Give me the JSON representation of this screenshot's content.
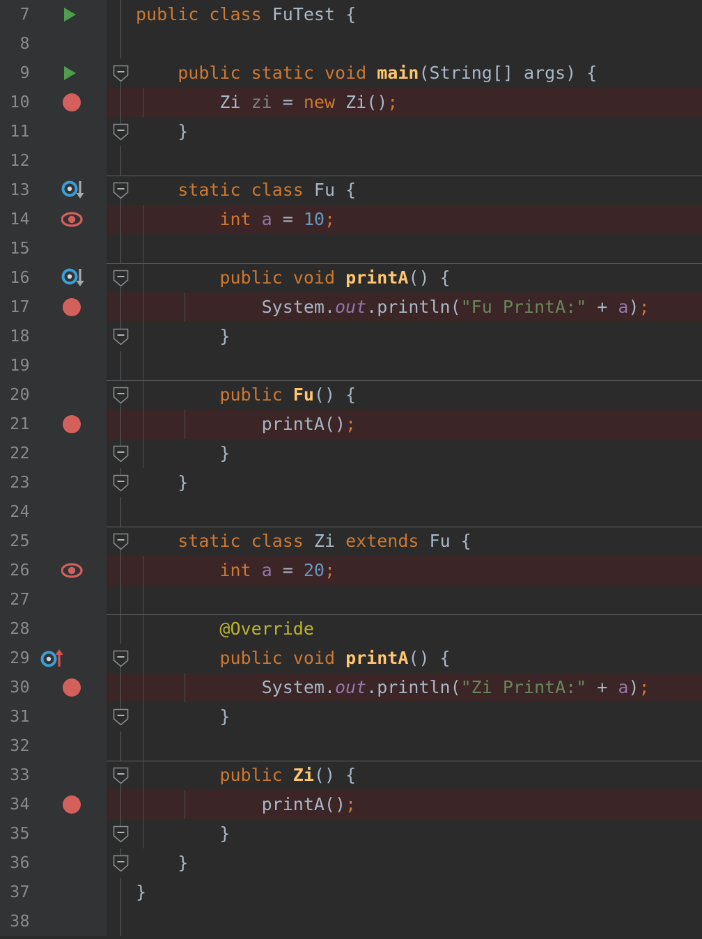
{
  "editor": {
    "colors": {
      "background": "#2b2b2b",
      "gutter_background": "#313335",
      "highlight_line": "#3b2526",
      "line_number": "#888b8d",
      "default_text": "#a9b7c6",
      "keyword": "#cc7832",
      "method": "#ffc66d",
      "field": "#9876aa",
      "number": "#6897bb",
      "string": "#6a8759",
      "annotation": "#bbb529",
      "dimmed": "#808080",
      "breakpoint": "#d4605c",
      "run_marker": "#4f9e4f",
      "implemented_marker": "#389fd6"
    },
    "language": "java",
    "first_visible_line": 7,
    "last_visible_line": 38,
    "lines": [
      {
        "number": "7",
        "icon": "run-icon",
        "highlighted": false,
        "fold": "none",
        "separator": false,
        "indent_guides": 0,
        "tokens": [
          {
            "t": "public",
            "c": "kw"
          },
          {
            "t": " ",
            "c": "pln"
          },
          {
            "t": "class",
            "c": "kw"
          },
          {
            "t": " ",
            "c": "pln"
          },
          {
            "t": "FuTest",
            "c": "cls"
          },
          {
            "t": " {",
            "c": "pln"
          }
        ]
      },
      {
        "number": "8",
        "icon": "none",
        "highlighted": false,
        "fold": "none",
        "separator": false,
        "indent_guides": 0,
        "tokens": []
      },
      {
        "number": "9",
        "icon": "run-icon",
        "highlighted": false,
        "fold": "start",
        "separator": false,
        "indent_guides": 0,
        "tokens": [
          {
            "t": "    ",
            "c": "pln"
          },
          {
            "t": "public",
            "c": "kw"
          },
          {
            "t": " ",
            "c": "pln"
          },
          {
            "t": "static",
            "c": "kw"
          },
          {
            "t": " ",
            "c": "pln"
          },
          {
            "t": "void",
            "c": "kw"
          },
          {
            "t": " ",
            "c": "pln"
          },
          {
            "t": "main",
            "c": "mth bold"
          },
          {
            "t": "(String[] args) {",
            "c": "pln"
          }
        ]
      },
      {
        "number": "10",
        "icon": "breakpoint-icon",
        "highlighted": true,
        "fold": "body",
        "separator": false,
        "indent_guides": 1,
        "tokens": [
          {
            "t": "        ",
            "c": "pln"
          },
          {
            "t": "Zi",
            "c": "cls"
          },
          {
            "t": " ",
            "c": "pln"
          },
          {
            "t": "zi",
            "c": "dim"
          },
          {
            "t": " = ",
            "c": "pln"
          },
          {
            "t": "new",
            "c": "kw"
          },
          {
            "t": " ",
            "c": "pln"
          },
          {
            "t": "Zi",
            "c": "cls"
          },
          {
            "t": "()",
            "c": "pln"
          },
          {
            "t": ";",
            "c": "kw"
          }
        ]
      },
      {
        "number": "11",
        "icon": "none",
        "highlighted": false,
        "fold": "end",
        "separator": false,
        "indent_guides": 0,
        "tokens": [
          {
            "t": "    }",
            "c": "pln"
          }
        ]
      },
      {
        "number": "12",
        "icon": "none",
        "highlighted": false,
        "fold": "none",
        "separator": false,
        "indent_guides": 0,
        "tokens": []
      },
      {
        "number": "13",
        "icon": "overridden-by-icon",
        "highlighted": false,
        "fold": "start",
        "separator": true,
        "indent_guides": 0,
        "tokens": [
          {
            "t": "    ",
            "c": "pln"
          },
          {
            "t": "static",
            "c": "kw"
          },
          {
            "t": " ",
            "c": "pln"
          },
          {
            "t": "class",
            "c": "kw"
          },
          {
            "t": " ",
            "c": "pln"
          },
          {
            "t": "Fu",
            "c": "cls"
          },
          {
            "t": " {",
            "c": "pln"
          }
        ]
      },
      {
        "number": "14",
        "icon": "field-watch-icon",
        "highlighted": true,
        "fold": "body",
        "separator": false,
        "indent_guides": 1,
        "tokens": [
          {
            "t": "        ",
            "c": "pln"
          },
          {
            "t": "int",
            "c": "kw"
          },
          {
            "t": " ",
            "c": "pln"
          },
          {
            "t": "a",
            "c": "fld"
          },
          {
            "t": " = ",
            "c": "pln"
          },
          {
            "t": "10",
            "c": "num"
          },
          {
            "t": ";",
            "c": "kw"
          }
        ]
      },
      {
        "number": "15",
        "icon": "none",
        "highlighted": false,
        "fold": "body",
        "separator": false,
        "indent_guides": 1,
        "tokens": []
      },
      {
        "number": "16",
        "icon": "overridden-by-icon",
        "highlighted": false,
        "fold": "start",
        "separator": true,
        "indent_guides": 1,
        "tokens": [
          {
            "t": "        ",
            "c": "pln"
          },
          {
            "t": "public",
            "c": "kw"
          },
          {
            "t": " ",
            "c": "pln"
          },
          {
            "t": "void",
            "c": "kw"
          },
          {
            "t": " ",
            "c": "pln"
          },
          {
            "t": "printA",
            "c": "mth bold"
          },
          {
            "t": "() {",
            "c": "pln"
          }
        ]
      },
      {
        "number": "17",
        "icon": "breakpoint-icon",
        "highlighted": true,
        "fold": "body",
        "separator": false,
        "indent_guides": 2,
        "tokens": [
          {
            "t": "            ",
            "c": "pln"
          },
          {
            "t": "System",
            "c": "pln"
          },
          {
            "t": ".",
            "c": "pln"
          },
          {
            "t": "out",
            "c": "stat"
          },
          {
            "t": ".println(",
            "c": "pln"
          },
          {
            "t": "\"Fu PrintA:\"",
            "c": "str"
          },
          {
            "t": " + ",
            "c": "pln"
          },
          {
            "t": "a",
            "c": "fld"
          },
          {
            "t": ")",
            "c": "pln"
          },
          {
            "t": ";",
            "c": "kw"
          }
        ]
      },
      {
        "number": "18",
        "icon": "none",
        "highlighted": false,
        "fold": "end",
        "separator": false,
        "indent_guides": 1,
        "tokens": [
          {
            "t": "        }",
            "c": "pln"
          }
        ]
      },
      {
        "number": "19",
        "icon": "none",
        "highlighted": false,
        "fold": "body",
        "separator": false,
        "indent_guides": 1,
        "tokens": []
      },
      {
        "number": "20",
        "icon": "none",
        "highlighted": false,
        "fold": "start",
        "separator": true,
        "indent_guides": 1,
        "tokens": [
          {
            "t": "        ",
            "c": "pln"
          },
          {
            "t": "public",
            "c": "kw"
          },
          {
            "t": " ",
            "c": "pln"
          },
          {
            "t": "Fu",
            "c": "mth bold"
          },
          {
            "t": "() {",
            "c": "pln"
          }
        ]
      },
      {
        "number": "21",
        "icon": "breakpoint-icon",
        "highlighted": true,
        "fold": "body",
        "separator": false,
        "indent_guides": 2,
        "tokens": [
          {
            "t": "            ",
            "c": "pln"
          },
          {
            "t": "printA()",
            "c": "pln"
          },
          {
            "t": ";",
            "c": "kw"
          }
        ]
      },
      {
        "number": "22",
        "icon": "none",
        "highlighted": false,
        "fold": "end",
        "separator": false,
        "indent_guides": 1,
        "tokens": [
          {
            "t": "        }",
            "c": "pln"
          }
        ]
      },
      {
        "number": "23",
        "icon": "none",
        "highlighted": false,
        "fold": "end",
        "separator": false,
        "indent_guides": 0,
        "tokens": [
          {
            "t": "    }",
            "c": "pln"
          }
        ]
      },
      {
        "number": "24",
        "icon": "none",
        "highlighted": false,
        "fold": "none",
        "separator": false,
        "indent_guides": 0,
        "tokens": []
      },
      {
        "number": "25",
        "icon": "none",
        "highlighted": false,
        "fold": "start",
        "separator": true,
        "indent_guides": 0,
        "tokens": [
          {
            "t": "    ",
            "c": "pln"
          },
          {
            "t": "static",
            "c": "kw"
          },
          {
            "t": " ",
            "c": "pln"
          },
          {
            "t": "class",
            "c": "kw"
          },
          {
            "t": " ",
            "c": "pln"
          },
          {
            "t": "Zi",
            "c": "cls"
          },
          {
            "t": " ",
            "c": "pln"
          },
          {
            "t": "extends",
            "c": "kw"
          },
          {
            "t": " ",
            "c": "pln"
          },
          {
            "t": "Fu",
            "c": "cls"
          },
          {
            "t": " {",
            "c": "pln"
          }
        ]
      },
      {
        "number": "26",
        "icon": "field-watch-icon",
        "highlighted": true,
        "fold": "body",
        "separator": false,
        "indent_guides": 1,
        "tokens": [
          {
            "t": "        ",
            "c": "pln"
          },
          {
            "t": "int",
            "c": "kw"
          },
          {
            "t": " ",
            "c": "pln"
          },
          {
            "t": "a",
            "c": "fld"
          },
          {
            "t": " = ",
            "c": "pln"
          },
          {
            "t": "20",
            "c": "num"
          },
          {
            "t": ";",
            "c": "kw"
          }
        ]
      },
      {
        "number": "27",
        "icon": "none",
        "highlighted": false,
        "fold": "body",
        "separator": false,
        "indent_guides": 1,
        "tokens": []
      },
      {
        "number": "28",
        "icon": "none",
        "highlighted": false,
        "fold": "body",
        "separator": true,
        "indent_guides": 1,
        "tokens": [
          {
            "t": "        ",
            "c": "pln"
          },
          {
            "t": "@Override",
            "c": "ann"
          }
        ]
      },
      {
        "number": "29",
        "icon": "overrides-icon",
        "highlighted": false,
        "fold": "start",
        "separator": false,
        "indent_guides": 1,
        "tokens": [
          {
            "t": "        ",
            "c": "pln"
          },
          {
            "t": "public",
            "c": "kw"
          },
          {
            "t": " ",
            "c": "pln"
          },
          {
            "t": "void",
            "c": "kw"
          },
          {
            "t": " ",
            "c": "pln"
          },
          {
            "t": "printA",
            "c": "mth bold"
          },
          {
            "t": "() {",
            "c": "pln"
          }
        ]
      },
      {
        "number": "30",
        "icon": "breakpoint-icon",
        "highlighted": true,
        "fold": "body",
        "separator": false,
        "indent_guides": 2,
        "tokens": [
          {
            "t": "            ",
            "c": "pln"
          },
          {
            "t": "System",
            "c": "pln"
          },
          {
            "t": ".",
            "c": "pln"
          },
          {
            "t": "out",
            "c": "stat"
          },
          {
            "t": ".println(",
            "c": "pln"
          },
          {
            "t": "\"Zi PrintA:\"",
            "c": "str"
          },
          {
            "t": " + ",
            "c": "pln"
          },
          {
            "t": "a",
            "c": "fld"
          },
          {
            "t": ")",
            "c": "pln"
          },
          {
            "t": ";",
            "c": "kw"
          }
        ]
      },
      {
        "number": "31",
        "icon": "none",
        "highlighted": false,
        "fold": "end",
        "separator": false,
        "indent_guides": 1,
        "tokens": [
          {
            "t": "        }",
            "c": "pln"
          }
        ]
      },
      {
        "number": "32",
        "icon": "none",
        "highlighted": false,
        "fold": "body",
        "separator": false,
        "indent_guides": 1,
        "tokens": []
      },
      {
        "number": "33",
        "icon": "none",
        "highlighted": false,
        "fold": "start",
        "separator": true,
        "indent_guides": 1,
        "tokens": [
          {
            "t": "        ",
            "c": "pln"
          },
          {
            "t": "public",
            "c": "kw"
          },
          {
            "t": " ",
            "c": "pln"
          },
          {
            "t": "Zi",
            "c": "mth bold"
          },
          {
            "t": "() {",
            "c": "pln"
          }
        ]
      },
      {
        "number": "34",
        "icon": "breakpoint-icon",
        "highlighted": true,
        "fold": "body",
        "separator": false,
        "indent_guides": 2,
        "tokens": [
          {
            "t": "            ",
            "c": "pln"
          },
          {
            "t": "printA()",
            "c": "pln"
          },
          {
            "t": ";",
            "c": "kw"
          }
        ]
      },
      {
        "number": "35",
        "icon": "none",
        "highlighted": false,
        "fold": "end",
        "separator": false,
        "indent_guides": 1,
        "tokens": [
          {
            "t": "        }",
            "c": "pln"
          }
        ]
      },
      {
        "number": "36",
        "icon": "none",
        "highlighted": false,
        "fold": "end",
        "separator": false,
        "indent_guides": 0,
        "tokens": [
          {
            "t": "    }",
            "c": "pln"
          }
        ]
      },
      {
        "number": "37",
        "icon": "none",
        "highlighted": false,
        "fold": "body",
        "separator": false,
        "indent_guides": 0,
        "tokens": [
          {
            "t": "}",
            "c": "pln"
          }
        ]
      },
      {
        "number": "38",
        "icon": "none",
        "highlighted": false,
        "fold": "body",
        "separator": false,
        "indent_guides": 0,
        "tokens": []
      }
    ]
  }
}
